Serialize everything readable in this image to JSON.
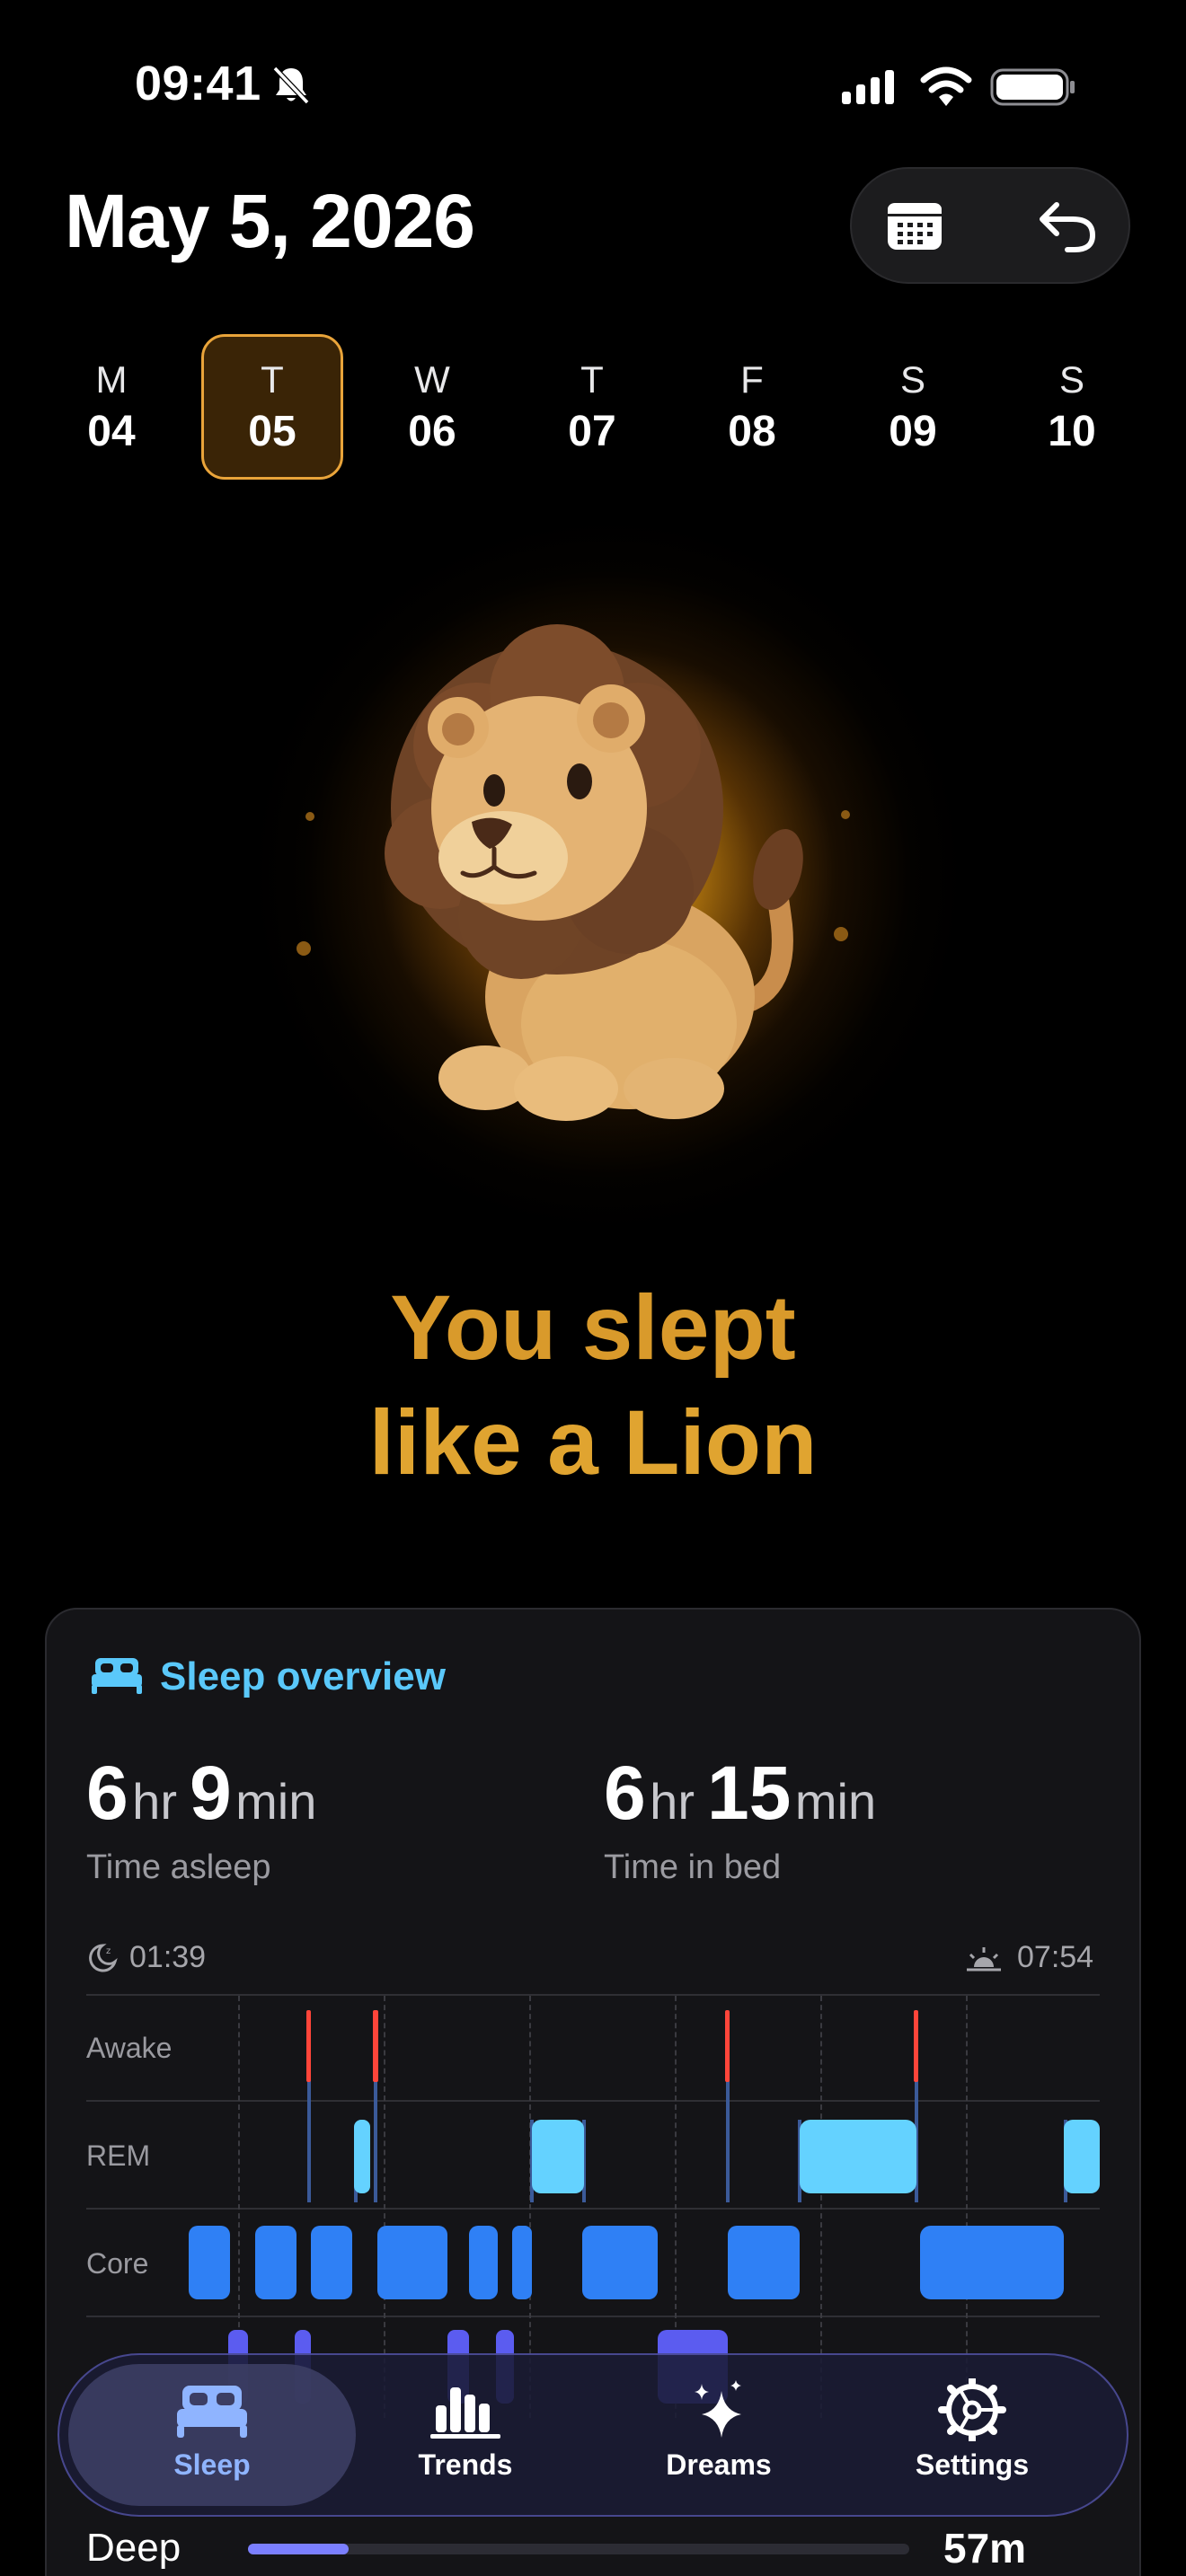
{
  "status_bar": {
    "time": "09:41"
  },
  "header": {
    "date_title": "May 5, 2026"
  },
  "week": {
    "days": [
      {
        "dow": "M",
        "num": "04",
        "selected": false
      },
      {
        "dow": "T",
        "num": "05",
        "selected": true
      },
      {
        "dow": "W",
        "num": "06",
        "selected": false
      },
      {
        "dow": "T",
        "num": "07",
        "selected": false
      },
      {
        "dow": "F",
        "num": "08",
        "selected": false
      },
      {
        "dow": "S",
        "num": "09",
        "selected": false
      },
      {
        "dow": "S",
        "num": "10",
        "selected": false
      }
    ]
  },
  "hero": {
    "line1": "You slept",
    "line2": "like a Lion"
  },
  "overview": {
    "title": "Sleep overview",
    "asleep": {
      "hours": "6",
      "hr_unit": "hr",
      "minutes": "9",
      "min_unit": "min",
      "label": "Time asleep"
    },
    "in_bed": {
      "hours": "6",
      "hr_unit": "hr",
      "minutes": "15",
      "min_unit": "min",
      "label": "Time in bed"
    },
    "start_time": "01:39",
    "end_time": "07:54",
    "stages": [
      "Awake",
      "REM",
      "Core"
    ],
    "colors": {
      "awake": "#ff453a",
      "rem": "#64d2ff",
      "core": "#2f80f5",
      "deep": "#5b5cf0"
    }
  },
  "deep_row": {
    "label": "Deep",
    "value": "57m",
    "fraction": 0.15
  },
  "tabs": [
    {
      "label": "Sleep",
      "icon": "bed-icon",
      "active": true
    },
    {
      "label": "Trends",
      "icon": "bar-chart-icon",
      "active": false
    },
    {
      "label": "Dreams",
      "icon": "sparkles-icon",
      "active": false
    },
    {
      "label": "Settings",
      "icon": "gear-icon",
      "active": false
    }
  ]
}
